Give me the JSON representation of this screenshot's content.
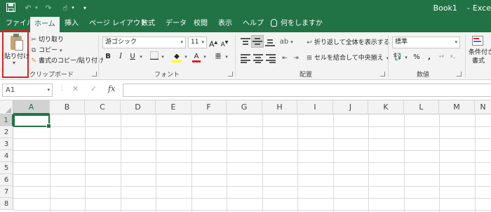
{
  "title": {
    "filename": "Book1",
    "separator": "-",
    "app": "Exce"
  },
  "quick_access": {
    "save_icon": "save-icon",
    "undo_icon": "undo-icon",
    "redo_icon": "redo-icon",
    "touch_icon": "touch-mode-icon",
    "customize": "▾"
  },
  "tabs": [
    {
      "label": "ファイル",
      "active": false
    },
    {
      "label": "ホーム",
      "active": true
    },
    {
      "label": "挿入",
      "active": false
    },
    {
      "label": "ページ レイアウト",
      "active": false
    },
    {
      "label": "数式",
      "active": false
    },
    {
      "label": "データ",
      "active": false
    },
    {
      "label": "校閲",
      "active": false
    },
    {
      "label": "表示",
      "active": false
    },
    {
      "label": "ヘルプ",
      "active": false
    }
  ],
  "tell_me": "何をしますか",
  "clipboard": {
    "paste": "貼り付け",
    "cut": "切り取り",
    "copy": "コピー",
    "format_painter": "書式のコピー/貼り付け",
    "group_label": "クリップボード"
  },
  "font": {
    "name": "游ゴシック",
    "size": "11",
    "bold": "B",
    "italic": "I",
    "underline": "U",
    "font_color_letter": "A",
    "phonetic": "亜",
    "grow": "A",
    "shrink": "A",
    "group_label": "フォント",
    "highlight_color": "#ffff00",
    "font_color": "#e02020"
  },
  "alignment": {
    "wrap_text": "折り返して全体を表示する",
    "merge_center": "セルを結合して中央揃え",
    "group_label": "配置"
  },
  "number": {
    "format": "標準",
    "percent": "%",
    "comma": ",",
    "group_label": "数値"
  },
  "styles": {
    "conditional_line1": "条件付き",
    "conditional_line2": "書式"
  },
  "formula_bar": {
    "name_box": "A1",
    "cancel": "✕",
    "enter": "✓",
    "fx": "fx",
    "formula": ""
  },
  "sheet": {
    "columns": [
      "A",
      "B",
      "C",
      "D",
      "E",
      "F",
      "G",
      "H",
      "I",
      "J",
      "K",
      "L",
      "M",
      "N"
    ],
    "rows": [
      "1",
      "2",
      "3",
      "4",
      "5",
      "6",
      "7",
      "8"
    ],
    "active_cell": "A1"
  },
  "colors": {
    "brand": "#217346",
    "highlight_border": "#e02020"
  }
}
